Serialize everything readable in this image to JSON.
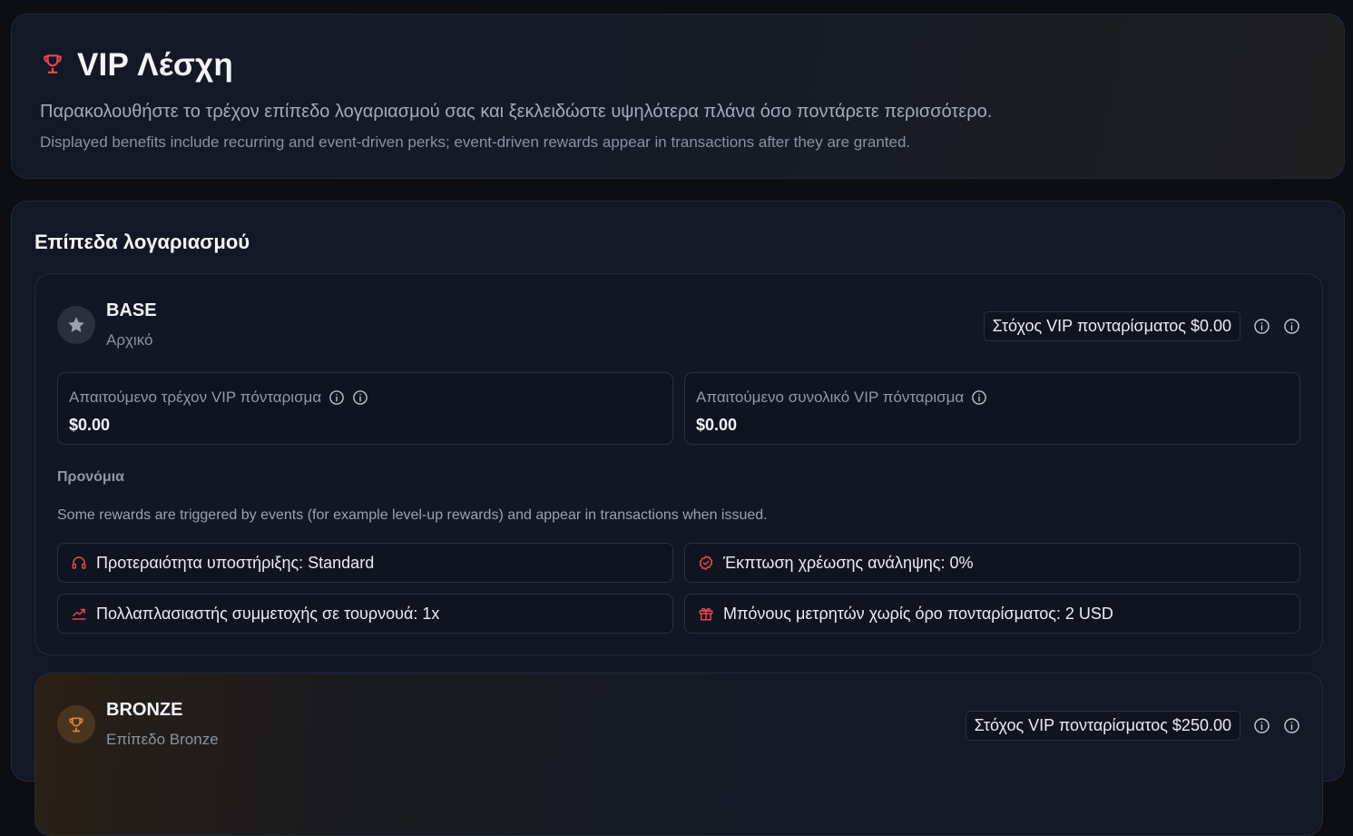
{
  "header": {
    "title": "VIP Λέσχη",
    "icon": "trophy-icon",
    "accent": "#e5484d",
    "subtitle": "Παρακολουθήστε το τρέχον επίπεδο λογαριασμού σας και ξεκλειδώστε υψηλότερα πλάνα όσο ποντάρετε περισσότερο.",
    "note": "Displayed benefits include recurring and event-driven perks; event-driven rewards appear in transactions after they are granted."
  },
  "levels_section": {
    "title": "Επίπεδα λογαριασμού",
    "levels": [
      {
        "name": "BASE",
        "subtitle": "Αρχικό",
        "icon": "star-icon",
        "target": "Στόχος VIP πονταρίσματος $0.00",
        "current_wager_label": "Απαιτούμενο τρέχον VIP πόνταρισμα",
        "current_wager_value": "$0.00",
        "total_wager_label": "Απαιτούμενο συνολικό VIP πόνταρισμα",
        "total_wager_value": "$0.00",
        "perks_title": "Προνόμια",
        "perks_note": "Some rewards are triggered by events (for example level-up rewards) and appear in transactions when issued.",
        "perks": [
          {
            "icon": "headset-icon",
            "label": "Προτεραιότητα υποστήριξης: Standard"
          },
          {
            "icon": "badge-check-icon",
            "label": "Έκπτωση χρέωσης ανάληψης: 0%"
          },
          {
            "icon": "trending-up-icon",
            "label": "Πολλαπλασιαστής συμμετοχής σε τουρνουά: 1x"
          },
          {
            "icon": "gift-icon",
            "label": "Μπόνους μετρητών χωρίς όρο πονταρίσματος: 2 USD"
          }
        ]
      },
      {
        "name": "BRONZE",
        "subtitle": "Επίπεδο Bronze",
        "icon": "trophy-icon",
        "accent": "#d98a3a",
        "target": "Στόχος VIP πονταρίσματος $250.00"
      }
    ]
  }
}
